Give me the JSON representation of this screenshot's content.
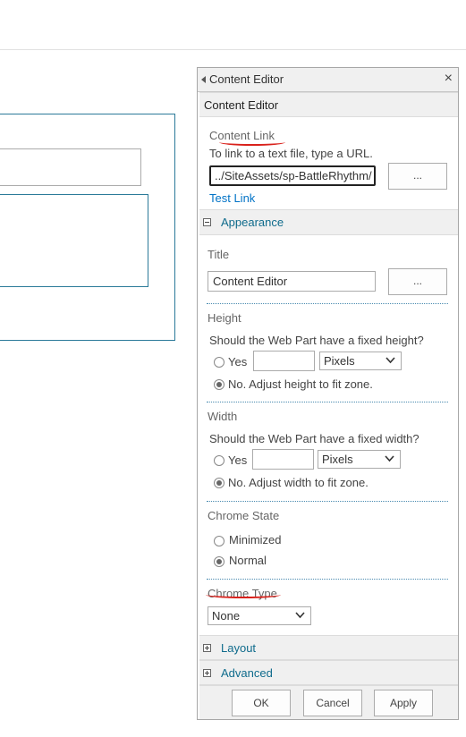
{
  "panel": {
    "title": "Content Editor",
    "close_glyph": "×"
  },
  "section": {
    "title": "Content Editor"
  },
  "content_link": {
    "label": "Content Link",
    "description": "To link to a text file, type a URL.",
    "value": "../SiteAssets/sp-BattleRhythm/",
    "browse_label": "...",
    "test_link": "Test Link"
  },
  "appearance": {
    "group_label": "Appearance",
    "title_label": "Title",
    "title_value": "Content Editor",
    "title_browse_label": "...",
    "height": {
      "label": "Height",
      "question": "Should the Web Part have a fixed height?",
      "yes_label": "Yes",
      "unit": "Pixels",
      "no_label": "No. Adjust height to fit zone."
    },
    "width": {
      "label": "Width",
      "question": "Should the Web Part have a fixed width?",
      "yes_label": "Yes",
      "unit": "Pixels",
      "no_label": "No. Adjust width to fit zone."
    },
    "chrome_state": {
      "label": "Chrome State",
      "options": [
        "Minimized",
        "Normal"
      ],
      "selected": "Normal"
    },
    "chrome_type": {
      "label": "Chrome Type",
      "value": "None"
    }
  },
  "groups": {
    "layout": "Layout",
    "advanced": "Advanced"
  },
  "footer": {
    "ok": "OK",
    "cancel": "Cancel",
    "apply": "Apply"
  },
  "colors": {
    "group_link": "#0f6b8c",
    "link": "#0072c6",
    "annotation": "#d9211b",
    "zone_border": "#2b7a99"
  }
}
